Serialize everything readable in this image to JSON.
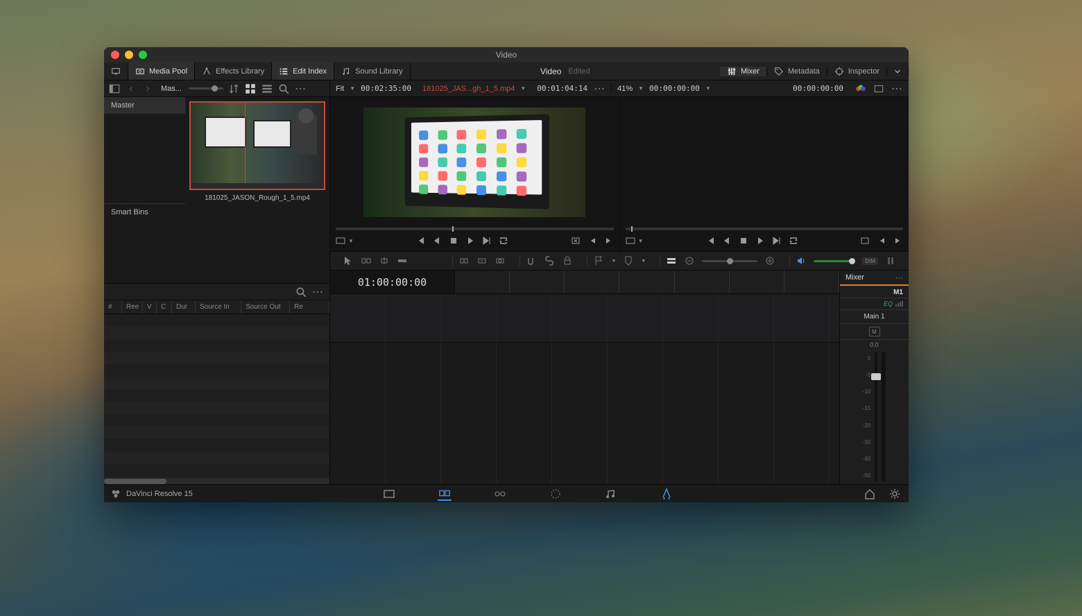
{
  "window": {
    "title": "Video"
  },
  "topbar": {
    "media_pool": "Media Pool",
    "effects_library": "Effects Library",
    "edit_index": "Edit Index",
    "sound_library": "Sound Library",
    "center_title": "Video",
    "center_sub": "Edited",
    "mixer": "Mixer",
    "metadata": "Metadata",
    "inspector": "Inspector"
  },
  "subbar": {
    "bin_label": "Mas...",
    "fit": "Fit",
    "src_duration": "00:02:35:00",
    "src_file": "181025_JAS...gh_1_5.mp4",
    "src_tc": "00:01:04:14",
    "zoom": "41%",
    "rec_tc_left": "00:00:00:00",
    "rec_tc_right": "00:00:00:00"
  },
  "bins": {
    "master": "Master",
    "smart": "Smart Bins",
    "clip_name": "181025_JASON_Rough_1_5.mp4"
  },
  "edit_index": {
    "cols": [
      "#",
      "Ree",
      "V",
      "C",
      "Dur",
      "Source In",
      "Source Out",
      "Re"
    ]
  },
  "timeline": {
    "timecode": "01:00:00:00"
  },
  "mixer": {
    "title": "Mixer",
    "channel": "M1",
    "eq": "EQ",
    "main": "Main 1",
    "mute": "M",
    "db": "0.0",
    "scale": [
      "0",
      "-5",
      "-10",
      "-15",
      "-20",
      "-30",
      "-40",
      "-50"
    ]
  },
  "toolbar": {
    "dim": "DIM"
  },
  "bottombar": {
    "app": "DaVinci Resolve 15"
  }
}
